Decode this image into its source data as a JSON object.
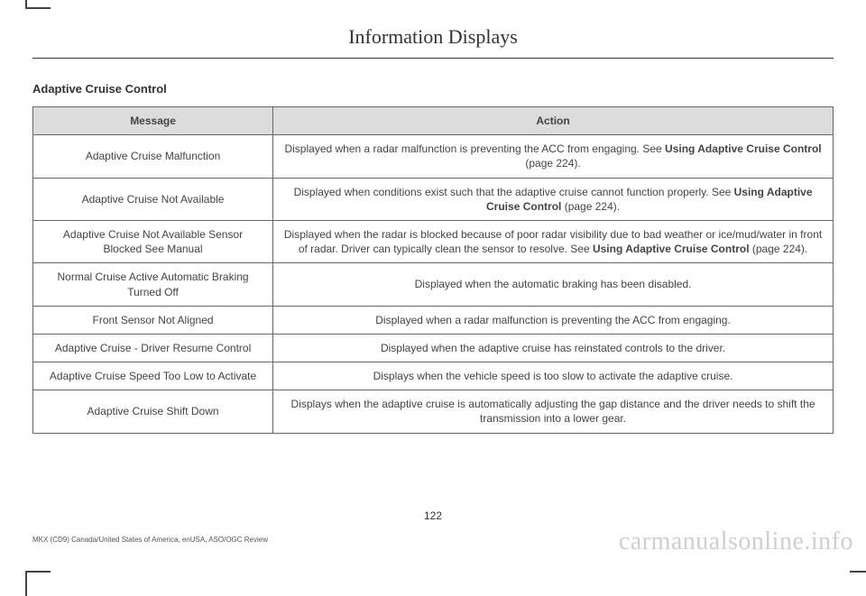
{
  "chapter_title": "Information Displays",
  "section_heading": "Adaptive Cruise Control",
  "table": {
    "headers": {
      "message": "Message",
      "action": "Action"
    },
    "rows": [
      {
        "message": "Adaptive Cruise Malfunction",
        "action_pre": "Displayed when a radar malfunction is preventing the ACC from engaging.  See ",
        "action_bold": "Using Adaptive Cruise Control",
        "action_post": " (page 224)."
      },
      {
        "message": "Adaptive Cruise Not Available",
        "action_pre": "Displayed when conditions exist such that the adaptive cruise cannot function properly.  See ",
        "action_bold": "Using Adaptive Cruise Control",
        "action_post": " (page 224)."
      },
      {
        "message": "Adaptive Cruise Not Available Sensor Blocked See Manual",
        "action_pre": "Displayed when the radar is blocked because of poor radar visibility due to bad weather or ice/mud/water in front of radar. Driver can typically clean the sensor to resolve.  See ",
        "action_bold": "Using Adaptive Cruise Control",
        "action_post": " (page 224)."
      },
      {
        "message": "Normal Cruise Active Automatic Braking Turned Off",
        "action_pre": "Displayed when the automatic braking has been disabled.",
        "action_bold": "",
        "action_post": ""
      },
      {
        "message": "Front Sensor Not Aligned",
        "action_pre": "Displayed when a radar malfunction is preventing the ACC from engaging.",
        "action_bold": "",
        "action_post": ""
      },
      {
        "message": "Adaptive Cruise - Driver Resume Control",
        "action_pre": "Displayed when the adaptive cruise has reinstated controls to the driver.",
        "action_bold": "",
        "action_post": ""
      },
      {
        "message": "Adaptive Cruise Speed Too Low to Activate",
        "action_pre": "Displays when the vehicle speed is too slow to activate the adaptive cruise.",
        "action_bold": "",
        "action_post": ""
      },
      {
        "message": "Adaptive Cruise Shift Down",
        "action_pre": "Displays when the adaptive cruise is automatically adjusting the gap distance and the driver needs to shift the transmission into a lower gear.",
        "action_bold": "",
        "action_post": ""
      }
    ]
  },
  "page_number": "122",
  "fineprint": "MKX (CD9) Canada/United States of America, enUSA, ASO/OGC Review",
  "watermark": "carmanualsonline.info"
}
